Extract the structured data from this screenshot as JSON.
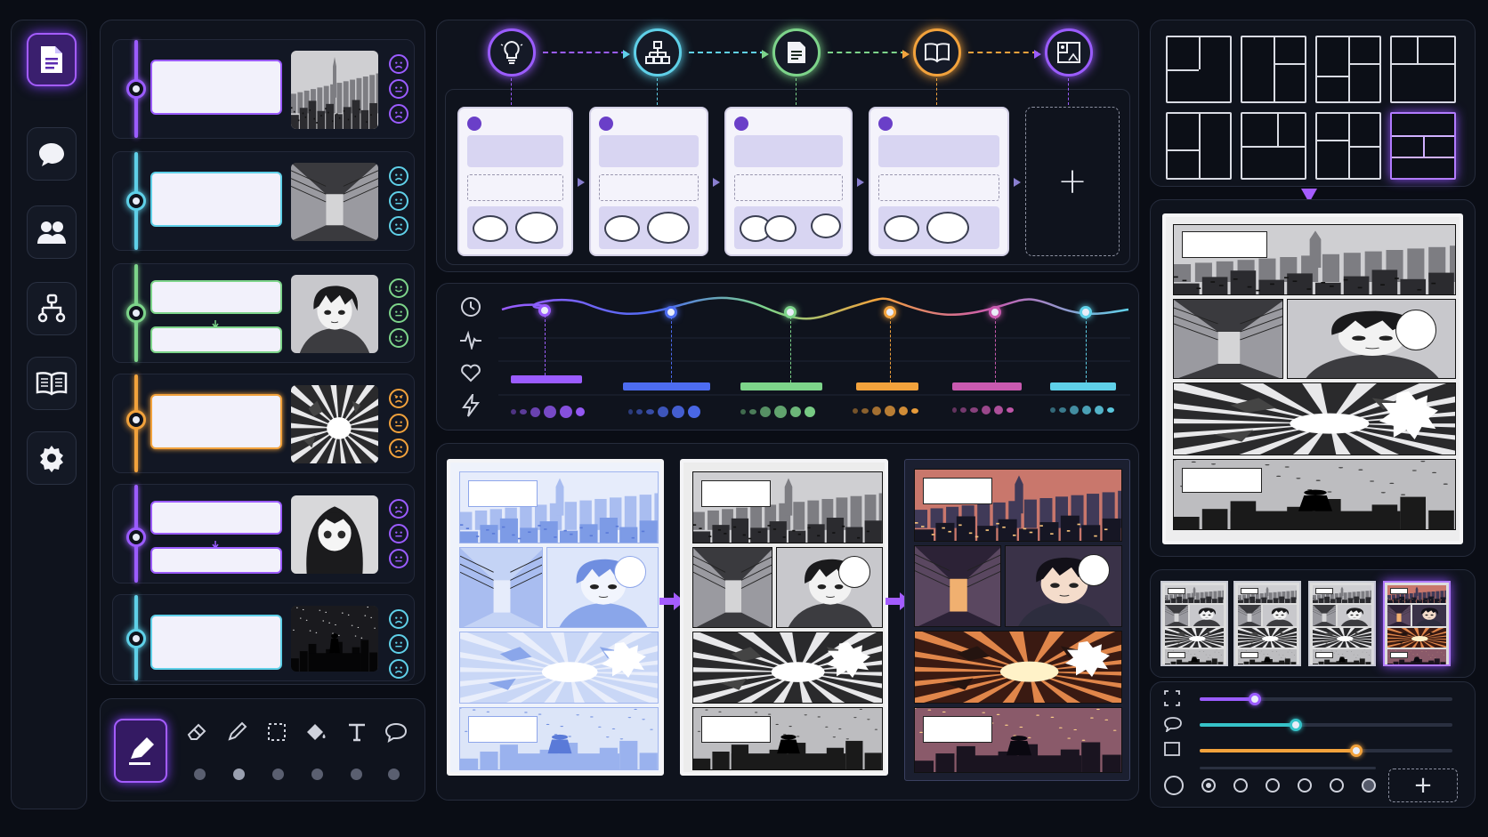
{
  "colors": {
    "purple": "#9b5cff",
    "cyan": "#5fd0e8",
    "green": "#7dd48a",
    "orange": "#f2a23c",
    "blue": "#4d6cf0",
    "magenta": "#c95ab0",
    "teal": "#36c2c8"
  },
  "rail": {
    "items": [
      {
        "icon": "document-icon",
        "active": true
      },
      {
        "icon": "chat-bubble-icon"
      },
      {
        "icon": "users-icon"
      },
      {
        "icon": "hierarchy-icon"
      },
      {
        "icon": "book-icon"
      },
      {
        "icon": "gear-icon"
      }
    ]
  },
  "story_rows": [
    {
      "color": "purple",
      "thumb": "city-skyline",
      "mood": [
        "sad",
        "neutral",
        "sad"
      ]
    },
    {
      "color": "cyan",
      "thumb": "alley",
      "mood": [
        "sad",
        "neutral",
        "sad"
      ]
    },
    {
      "color": "green",
      "thumb": "boy-portrait",
      "mood": [
        "happy",
        "neutral",
        "happy"
      ]
    },
    {
      "color": "orange",
      "thumb": "explosion",
      "mood": [
        "angry",
        "neutral",
        "sad"
      ]
    },
    {
      "color": "purple",
      "thumb": "girl-portrait",
      "mood": [
        "sad",
        "neutral",
        "neutral"
      ]
    },
    {
      "color": "cyan",
      "thumb": "night-city",
      "mood": [
        "sad",
        "neutral",
        "sad"
      ]
    }
  ],
  "flow": {
    "steps": [
      {
        "icon": "lightbulb-icon",
        "color": "purple"
      },
      {
        "icon": "org-chart-icon",
        "color": "cyan"
      },
      {
        "icon": "document-icon",
        "color": "green"
      },
      {
        "icon": "open-book-icon",
        "color": "orange"
      },
      {
        "icon": "image-panel-icon",
        "color": "purple"
      }
    ],
    "add_label": "+"
  },
  "timeline": {
    "row_icons": [
      "clock-icon",
      "pulse-icon",
      "heart-icon",
      "lightning-icon"
    ],
    "points": [
      {
        "color": "purple"
      },
      {
        "color": "blue"
      },
      {
        "color": "green"
      },
      {
        "color": "orange"
      },
      {
        "color": "magenta"
      },
      {
        "color": "cyan"
      }
    ]
  },
  "pipeline": {
    "stages": [
      "sketch",
      "ink",
      "color"
    ]
  },
  "layouts": {
    "count": 8,
    "selected_index": 7
  },
  "preview_pages": {
    "count": 4,
    "selected_index": 3
  },
  "toolbar": {
    "tools": [
      "pen-icon",
      "eraser-icon",
      "pencil-icon",
      "marquee-select-icon",
      "fill-bucket-icon",
      "text-icon",
      "speech-bubble-icon"
    ]
  },
  "adjust": {
    "sliders": [
      {
        "icon": "frame-icon",
        "value": 0.22,
        "color": "purple"
      },
      {
        "icon": "bubble-icon",
        "value": 0.38,
        "color": "teal"
      },
      {
        "icon": "panel-icon",
        "value": 0.62,
        "color": "orange"
      }
    ],
    "add_label": "+"
  }
}
